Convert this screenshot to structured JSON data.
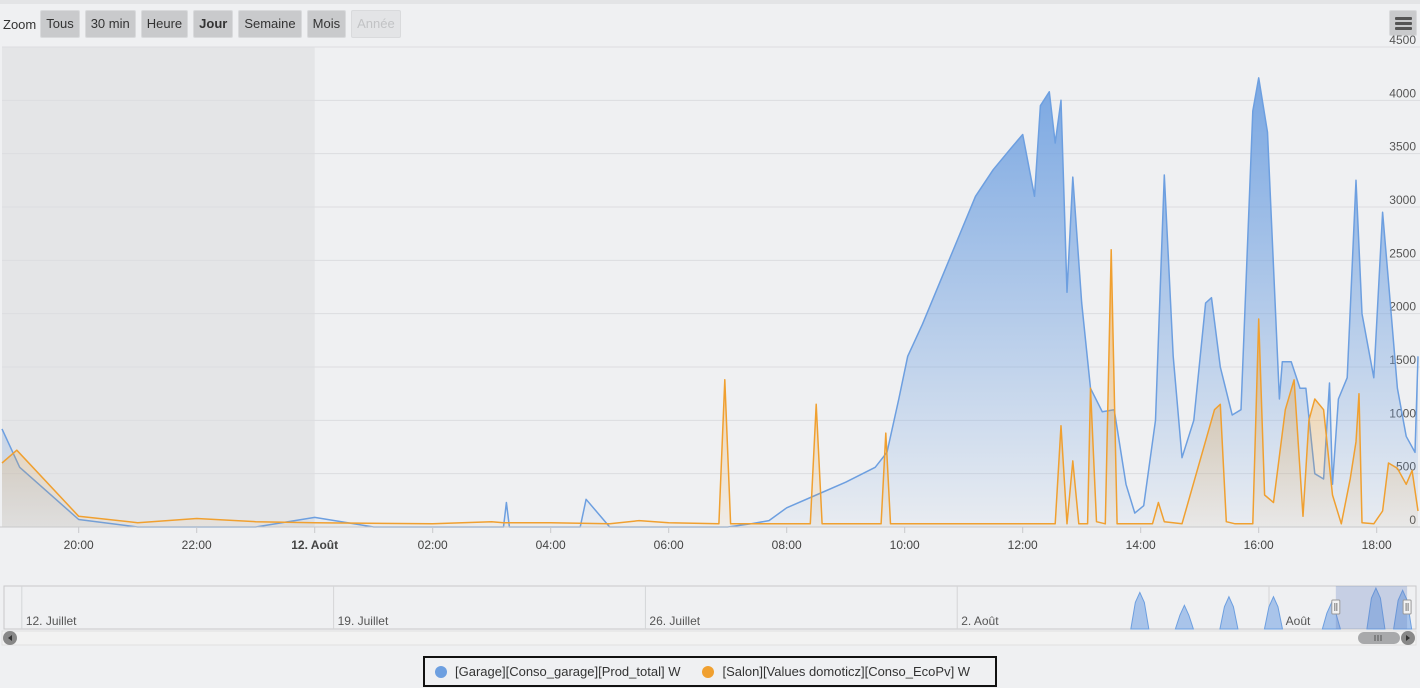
{
  "zoom": {
    "label": "Zoom",
    "buttons": [
      {
        "label": "Tous",
        "state": "normal"
      },
      {
        "label": "30 min",
        "state": "normal"
      },
      {
        "label": "Heure",
        "state": "normal"
      },
      {
        "label": "Jour",
        "state": "active"
      },
      {
        "label": "Semaine",
        "state": "normal"
      },
      {
        "label": "Mois",
        "state": "normal"
      },
      {
        "label": "Année",
        "state": "disabled"
      }
    ]
  },
  "menu_icon": "hamburger-menu-icon",
  "colors": {
    "series_1": "#6d9fe0",
    "series_2": "#f0a030",
    "background": "#eff0f2",
    "highlight_band": "#e4e5e7"
  },
  "chart_data": {
    "type": "area",
    "title": "",
    "xlabel": "",
    "ylabel": "",
    "y_ticks": [
      "0",
      "500",
      "1000",
      "1500",
      "2000",
      "2500",
      "3000",
      "3500",
      "4000",
      "4500"
    ],
    "ylim": [
      0,
      4500
    ],
    "x_unit": "hours from 12 Août 00:00 (negative = 11 Août)",
    "xlim": [
      -5.3,
      18.7
    ],
    "x_ticks": [
      {
        "t": -4,
        "label": "20:00",
        "bold": false
      },
      {
        "t": -2,
        "label": "22:00",
        "bold": false
      },
      {
        "t": 0,
        "label": "12. Août",
        "bold": true
      },
      {
        "t": 2,
        "label": "02:00",
        "bold": false
      },
      {
        "t": 4,
        "label": "04:00",
        "bold": false
      },
      {
        "t": 6,
        "label": "06:00",
        "bold": false
      },
      {
        "t": 8,
        "label": "08:00",
        "bold": false
      },
      {
        "t": 10,
        "label": "10:00",
        "bold": false
      },
      {
        "t": 12,
        "label": "12:00",
        "bold": false
      },
      {
        "t": 14,
        "label": "14:00",
        "bold": false
      },
      {
        "t": 16,
        "label": "16:00",
        "bold": false
      },
      {
        "t": 18,
        "label": "18:00",
        "bold": false
      }
    ],
    "highlight_band": [
      -5.3,
      0
    ],
    "grid": true,
    "legend_position": "bottom-center",
    "series": [
      {
        "name": "[Garage][Conso_garage][Prod_total] W",
        "color": "#6d9fe0",
        "points": [
          [
            -5.3,
            920
          ],
          [
            -5.0,
            560
          ],
          [
            -4.0,
            70
          ],
          [
            -3.0,
            0
          ],
          [
            -1.0,
            0
          ],
          [
            0.0,
            90
          ],
          [
            1.0,
            0
          ],
          [
            3.2,
            0
          ],
          [
            3.25,
            230
          ],
          [
            3.3,
            0
          ],
          [
            4.5,
            0
          ],
          [
            4.6,
            260
          ],
          [
            5.0,
            0
          ],
          [
            7.0,
            0
          ],
          [
            7.4,
            30
          ],
          [
            7.7,
            60
          ],
          [
            8.0,
            180
          ],
          [
            8.5,
            300
          ],
          [
            9.0,
            420
          ],
          [
            9.5,
            560
          ],
          [
            9.7,
            700
          ],
          [
            9.9,
            1200
          ],
          [
            10.05,
            1600
          ],
          [
            10.3,
            1900
          ],
          [
            10.6,
            2300
          ],
          [
            10.9,
            2700
          ],
          [
            11.2,
            3100
          ],
          [
            11.5,
            3350
          ],
          [
            11.8,
            3550
          ],
          [
            12.0,
            3680
          ],
          [
            12.2,
            3100
          ],
          [
            12.3,
            3950
          ],
          [
            12.45,
            4080
          ],
          [
            12.55,
            3600
          ],
          [
            12.65,
            4000
          ],
          [
            12.75,
            2200
          ],
          [
            12.85,
            3280
          ],
          [
            13.0,
            2100
          ],
          [
            13.15,
            1300
          ],
          [
            13.35,
            1080
          ],
          [
            13.55,
            1100
          ],
          [
            13.75,
            400
          ],
          [
            13.9,
            130
          ],
          [
            14.05,
            200
          ],
          [
            14.25,
            1000
          ],
          [
            14.4,
            3300
          ],
          [
            14.55,
            1600
          ],
          [
            14.7,
            650
          ],
          [
            14.9,
            1000
          ],
          [
            15.1,
            2100
          ],
          [
            15.2,
            2150
          ],
          [
            15.35,
            1500
          ],
          [
            15.55,
            1050
          ],
          [
            15.7,
            1100
          ],
          [
            15.9,
            3900
          ],
          [
            16.0,
            4210
          ],
          [
            16.15,
            3700
          ],
          [
            16.35,
            1200
          ],
          [
            16.4,
            1550
          ],
          [
            16.55,
            1550
          ],
          [
            16.7,
            1300
          ],
          [
            16.8,
            1300
          ],
          [
            16.95,
            500
          ],
          [
            17.1,
            450
          ],
          [
            17.2,
            1350
          ],
          [
            17.25,
            400
          ],
          [
            17.35,
            1200
          ],
          [
            17.5,
            1400
          ],
          [
            17.65,
            3250
          ],
          [
            17.75,
            2000
          ],
          [
            17.95,
            1400
          ],
          [
            18.1,
            2950
          ],
          [
            18.2,
            2300
          ],
          [
            18.35,
            1300
          ],
          [
            18.5,
            850
          ],
          [
            18.65,
            700
          ],
          [
            18.7,
            1600
          ]
        ]
      },
      {
        "name": "[Salon][Values domoticz][Conso_EcoPv] W",
        "color": "#f0a030",
        "points": [
          [
            -5.3,
            600
          ],
          [
            -5.05,
            720
          ],
          [
            -4.0,
            100
          ],
          [
            -3.0,
            40
          ],
          [
            -2.0,
            80
          ],
          [
            -1.0,
            50
          ],
          [
            0.0,
            40
          ],
          [
            2.0,
            30
          ],
          [
            3.0,
            50
          ],
          [
            3.2,
            40
          ],
          [
            4.0,
            40
          ],
          [
            5.0,
            30
          ],
          [
            5.5,
            60
          ],
          [
            6.0,
            40
          ],
          [
            6.85,
            30
          ],
          [
            6.95,
            1380
          ],
          [
            7.05,
            30
          ],
          [
            8.4,
            30
          ],
          [
            8.5,
            1150
          ],
          [
            8.6,
            30
          ],
          [
            9.6,
            30
          ],
          [
            9.68,
            880
          ],
          [
            9.76,
            30
          ],
          [
            11.0,
            30
          ],
          [
            12.55,
            30
          ],
          [
            12.65,
            950
          ],
          [
            12.75,
            30
          ],
          [
            12.85,
            620
          ],
          [
            12.95,
            30
          ],
          [
            13.1,
            30
          ],
          [
            13.15,
            1300
          ],
          [
            13.25,
            50
          ],
          [
            13.4,
            30
          ],
          [
            13.5,
            2600
          ],
          [
            13.6,
            30
          ],
          [
            14.2,
            30
          ],
          [
            14.3,
            230
          ],
          [
            14.4,
            50
          ],
          [
            14.7,
            30
          ],
          [
            15.25,
            1100
          ],
          [
            15.35,
            1150
          ],
          [
            15.45,
            50
          ],
          [
            15.6,
            30
          ],
          [
            15.9,
            30
          ],
          [
            16.0,
            1950
          ],
          [
            16.1,
            300
          ],
          [
            16.25,
            230
          ],
          [
            16.45,
            1100
          ],
          [
            16.6,
            1380
          ],
          [
            16.75,
            100
          ],
          [
            16.85,
            1000
          ],
          [
            16.95,
            1200
          ],
          [
            17.1,
            1100
          ],
          [
            17.25,
            300
          ],
          [
            17.4,
            30
          ],
          [
            17.55,
            450
          ],
          [
            17.65,
            800
          ],
          [
            17.7,
            1250
          ],
          [
            17.75,
            40
          ],
          [
            17.95,
            30
          ],
          [
            18.1,
            150
          ],
          [
            18.2,
            600
          ],
          [
            18.35,
            550
          ],
          [
            18.5,
            400
          ],
          [
            18.6,
            530
          ],
          [
            18.7,
            150
          ]
        ]
      }
    ]
  },
  "navigator": {
    "labels": [
      "12. Juillet",
      "19. Juillet",
      "26. Juillet",
      "2. Août",
      "9. Août"
    ],
    "label_days": [
      0,
      7,
      14,
      21,
      28
    ],
    "xlim_days": [
      -0.4,
      31.3
    ],
    "selection_days": [
      29.5,
      31.1
    ],
    "peaks": [
      {
        "day": 25.1,
        "h": 0.85
      },
      {
        "day": 26.1,
        "h": 0.55
      },
      {
        "day": 27.1,
        "h": 0.75
      },
      {
        "day": 28.1,
        "h": 0.75
      },
      {
        "day": 29.4,
        "h": 0.6
      },
      {
        "day": 30.4,
        "h": 0.95
      },
      {
        "day": 31.0,
        "h": 0.9
      }
    ]
  },
  "legend": {
    "items": [
      {
        "label": "[Garage][Conso_garage][Prod_total] W",
        "color": "#6d9fe0"
      },
      {
        "label": "[Salon][Values domoticz][Conso_EcoPv] W",
        "color": "#f0a030"
      }
    ]
  }
}
